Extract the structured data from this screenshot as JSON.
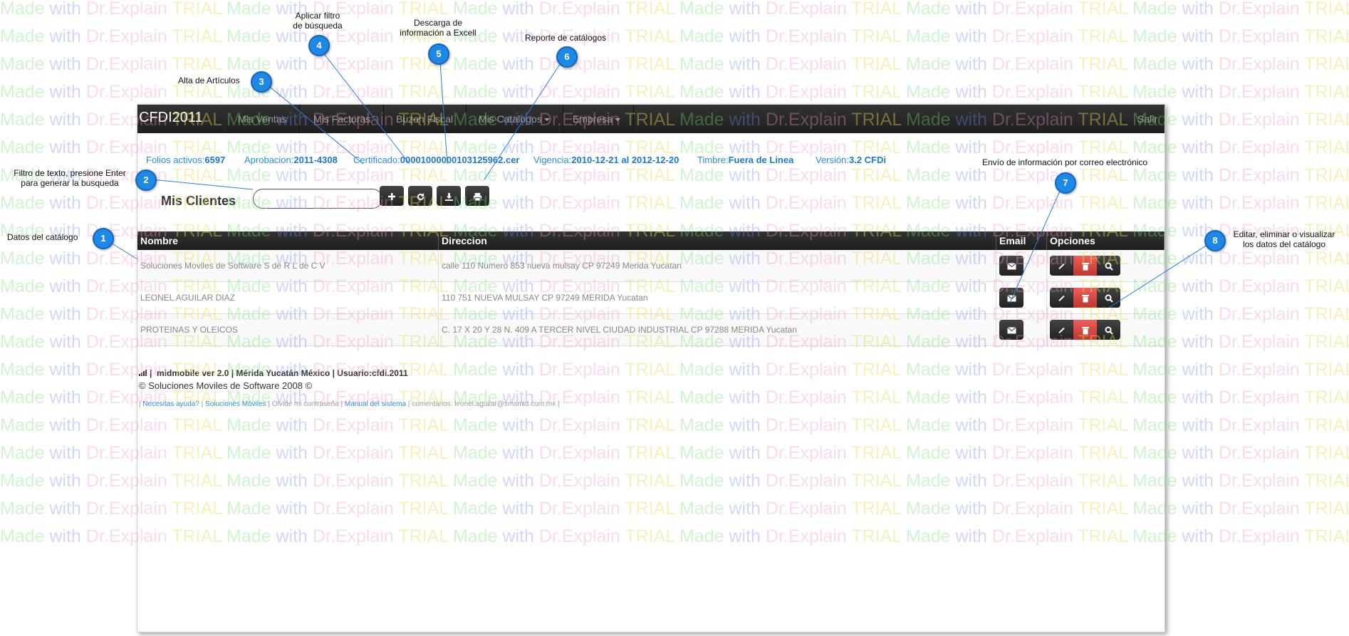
{
  "watermark": {
    "text_a": "Made ",
    "text_b": "with ",
    "text_c": "Dr.Explain ",
    "text_d": "TRIAL"
  },
  "navbar": {
    "brand": "CFDI2011",
    "items": [
      {
        "label": "Mis Ventas",
        "dropdown": false
      },
      {
        "label": "Mis Facturas",
        "dropdown": false
      },
      {
        "label": "Buzon Fiscal",
        "dropdown": false
      },
      {
        "label": "Mis Catalogos",
        "dropdown": true
      },
      {
        "label": "Empresa",
        "dropdown": true
      }
    ],
    "logout": "Salir"
  },
  "info_bar": {
    "folios_label": "Folios activos:",
    "folios_value": "6597",
    "aprobacion_label": "Aprobacion:",
    "aprobacion_value": "2011-4308",
    "certificado_label": "Certificado:",
    "certificado_value": "00001000000103125962.cer",
    "vigencia_label": "Vigencia:",
    "vigencia_value": "2010-12-21 al 2012-12-20",
    "timbre_label": "Timbre:",
    "timbre_value": "Fuera de Linea",
    "version_label": "Versión:",
    "version_value": "3.2 CFDi"
  },
  "page_title": "Mis Clientes",
  "search": {
    "value": "",
    "placeholder": ""
  },
  "toolbar": {
    "add_icon": "plus-icon",
    "refresh_icon": "refresh-icon",
    "download_icon": "download-icon",
    "print_icon": "print-icon"
  },
  "table": {
    "headers": {
      "nombre": "Nombre",
      "direccion": "Direccion",
      "email": "Email",
      "opciones": "Opciones"
    },
    "rows": [
      {
        "nombre": "Soluciones Moviles de Software S de R L de C V",
        "direccion": "calle 110 Numero 853 nueva mulsay CP 97249 Merida Yucatan"
      },
      {
        "nombre": "LEONEL AGUILAR DIAZ",
        "direccion": "110 751 NUEVA MULSAY CP 97249 MERIDA Yucatan"
      },
      {
        "nombre": "PROTEINAS Y OLEICOS",
        "direccion": "C. 17 X 20 Y 28 N. 409 A TERCER NIVEL CIUDAD INDUSTRIAL CP 97288 MERIDA Yucatan"
      }
    ]
  },
  "footer": {
    "line1": "midmobile ver 2.0 | Mérida Yucatán México | Usuario:cfdi.2011",
    "line2": "© Soluciones Moviles de Software 2008 ©",
    "links": [
      {
        "text": "Necesitas ayuda?",
        "link": true
      },
      {
        "text": "Soluciones Móviles",
        "link": true
      },
      {
        "text": "Olvide mi contraseña",
        "link": false
      },
      {
        "text": "Manual del sistema",
        "link": true
      },
      {
        "text": "comentarios: leonel.aguilar@smsmid.com.mx",
        "link": false
      }
    ]
  },
  "annotations": [
    {
      "num": "1",
      "text": "Datos del catálogo"
    },
    {
      "num": "2",
      "text": "Filtro de texto, presione Enter\npara generar la busqueda"
    },
    {
      "num": "3",
      "text": "Alta de Artículos"
    },
    {
      "num": "4",
      "text": "Aplicar filtro\nde búsqueda"
    },
    {
      "num": "5",
      "text": "Descarga de\ninformación a Excell"
    },
    {
      "num": "6",
      "text": "Reporte de catálogos"
    },
    {
      "num": "7",
      "text": "Envío de información por correo electrónico"
    },
    {
      "num": "8",
      "text": "Editar, eliminar o visualizar\nlos datos del catálogo"
    }
  ],
  "colors": {
    "accent": "#2a8bd6",
    "navbar": "#222222",
    "danger": "#da4f49",
    "annotation": "#1e88e5"
  }
}
